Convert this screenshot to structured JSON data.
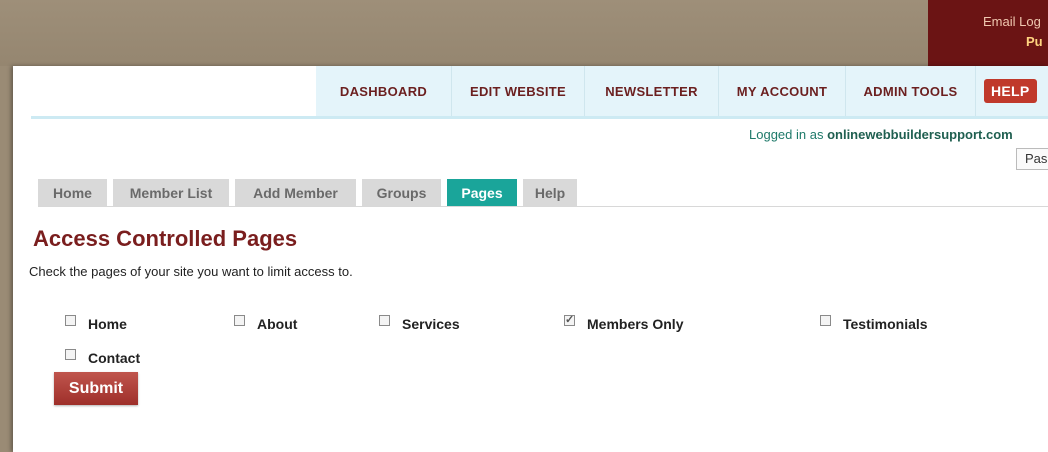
{
  "corner": {
    "email_label": "Email Log",
    "pub_label": "Pu"
  },
  "nav": {
    "dashboard": "DASHBOARD",
    "edit_website": "EDIT WEBSITE",
    "newsletter": "NEWSLETTER",
    "my_account": "MY ACCOUNT",
    "admin_tools": "ADMIN TOOLS",
    "help": "HELP"
  },
  "account": {
    "logged_prefix": "Logged in as ",
    "username": "onlinewebbuildersupport.com",
    "password_button": "Pas"
  },
  "tabs": {
    "home": "Home",
    "member_list": "Member List",
    "add_member": "Add Member",
    "groups": "Groups",
    "pages": "Pages",
    "help": "Help",
    "active": "Pages"
  },
  "page": {
    "title": "Access Controlled Pages",
    "instructions": "Check the pages of your site you want to limit access to."
  },
  "pages": [
    {
      "label": "Home",
      "checked": false
    },
    {
      "label": "About",
      "checked": false
    },
    {
      "label": "Services",
      "checked": false
    },
    {
      "label": "Members Only",
      "checked": true
    },
    {
      "label": "Testimonials",
      "checked": false
    },
    {
      "label": "Contact",
      "checked": false
    }
  ],
  "submit_label": "Submit",
  "colors": {
    "brand": "#7a1e1e",
    "tab_active": "#1aa59a",
    "nav_bg": "#e4f4fa",
    "help_button": "#c0392b"
  }
}
